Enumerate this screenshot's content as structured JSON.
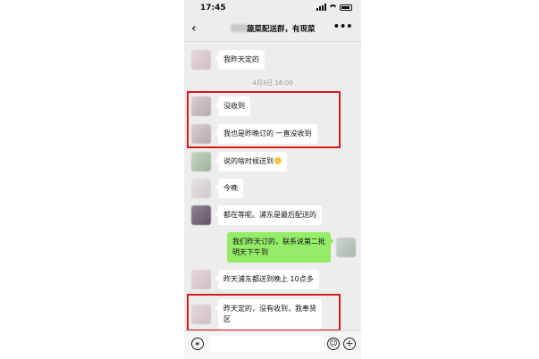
{
  "status_bar": {
    "time": "17:45"
  },
  "header": {
    "title": "蔬菜配送群，有现菜",
    "back_icon": "chevron-left-icon",
    "more_icon": "more-horizontal-icon"
  },
  "timestamp": "4月3日 16:00",
  "messages": [
    {
      "side": "left",
      "text": "我昨天定的"
    },
    {
      "side": "left",
      "text": "没收到"
    },
    {
      "side": "left",
      "text": "我也是昨晚订的 一直没收到"
    },
    {
      "side": "left",
      "text": "说的啥时候送到"
    },
    {
      "side": "left",
      "text": "今晚"
    },
    {
      "side": "left",
      "text": "都在等呢。浦东是最后配送的"
    },
    {
      "side": "right",
      "text_line1": "我们昨天订的，联系说第二批",
      "text_line2": "明天下午到"
    },
    {
      "side": "left",
      "text": "昨天浦东都送到晚上 10点多"
    },
    {
      "side": "left",
      "text_line1": "昨天定的，没有收到，我奉贤",
      "text_line2": "区"
    }
  ],
  "input_bar": {
    "voice_icon": "voice-icon",
    "emoji_icon": "emoji-icon",
    "plus_icon": "plus-icon",
    "value": ""
  },
  "highlight_color": "#d71920",
  "bubble_colors": {
    "incoming": "#ffffff",
    "outgoing": "#95ec69"
  }
}
